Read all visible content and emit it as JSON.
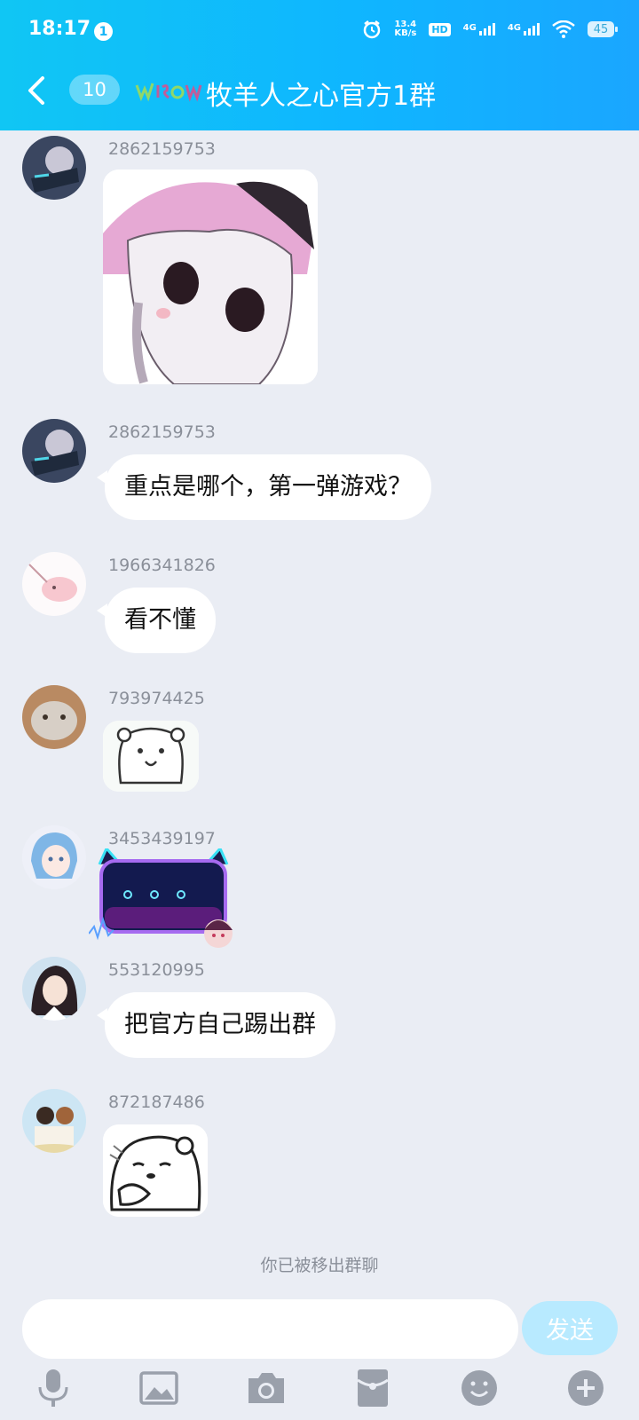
{
  "status_bar": {
    "time": "18:17",
    "notification_count": "1",
    "net_speed_value": "13.4",
    "net_speed_unit": "KB/s",
    "hd_label": "HD",
    "sim1_label": "4G",
    "sim2_label": "4G",
    "battery": "45"
  },
  "header": {
    "unread_count": "10",
    "group_name": "牧羊人之心官方1群"
  },
  "messages": [
    {
      "sender": "2862159753",
      "type": "sticker"
    },
    {
      "sender": "2862159753",
      "type": "text",
      "text": "重点是哪个，第一弹游戏？"
    },
    {
      "sender": "1966341826",
      "type": "text",
      "text": "看不懂"
    },
    {
      "sender": "793974425",
      "type": "sticker"
    },
    {
      "sender": "3453439197",
      "type": "sticker"
    },
    {
      "sender": "553120995",
      "type": "text",
      "text": "把官方自己踢出群"
    },
    {
      "sender": "872187486",
      "type": "sticker"
    }
  ],
  "system_note": "你已被移出群聊",
  "composer": {
    "placeholder": "",
    "send_label": "发送"
  },
  "toolbar_icons": [
    "microphone-icon",
    "image-icon",
    "camera-icon",
    "red-packet-icon",
    "emoji-icon",
    "plus-icon"
  ],
  "colors": {
    "header_start": "#10c6f4",
    "header_end": "#1aa6ff",
    "background": "#eaedf4",
    "send_button": "#b8eaff",
    "toolbar_icon": "#9aa0ab"
  }
}
